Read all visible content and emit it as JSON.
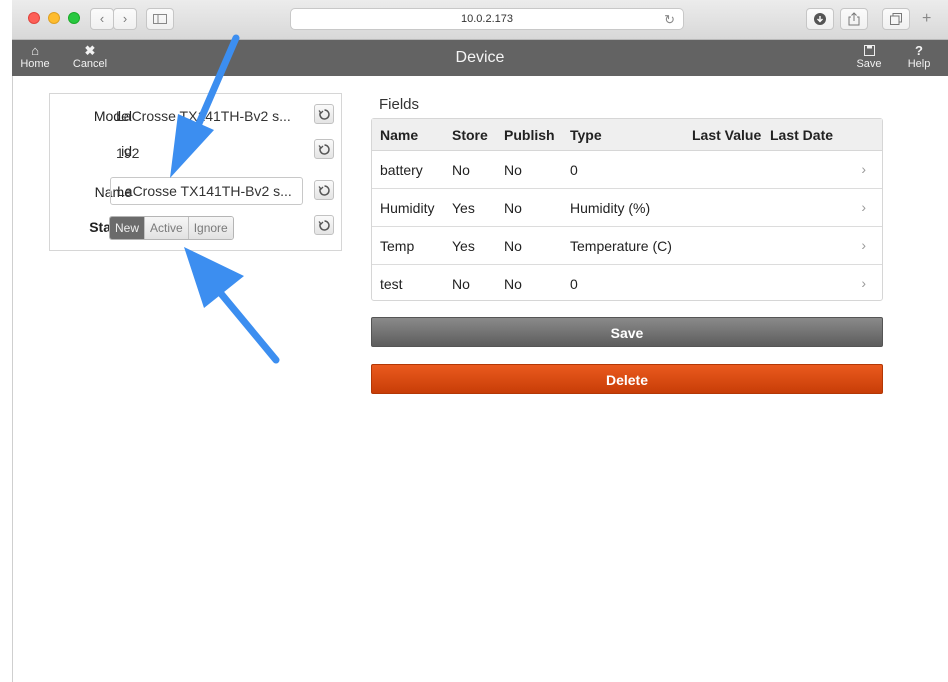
{
  "browser": {
    "address": "10.0.2.173",
    "back_glyph": "‹",
    "forward_glyph": "›",
    "plus_glyph": "+"
  },
  "navbar": {
    "title": "Device",
    "home_label": "Home",
    "cancel_label": "Cancel",
    "save_label": "Save",
    "help_label": "Help",
    "home_icon_glyph": "⌂",
    "cancel_icon_glyph": "✖",
    "help_icon_glyph": "?"
  },
  "device": {
    "model_label": "Model",
    "model_value": "LaCrosse TX141TH-Bv2 s...",
    "id_label": "id",
    "id_value": "192",
    "name_label": "Name",
    "name_value": "LaCrosse TX141TH-Bv2 s...",
    "status_label": "Status",
    "status_options": [
      "New",
      "Active",
      "Ignore"
    ],
    "status_selected": "New"
  },
  "fields": {
    "title": "Fields",
    "columns": [
      "Name",
      "Store",
      "Publish",
      "Type",
      "Last Value",
      "Last Date"
    ],
    "rows": [
      {
        "name": "battery",
        "store": "No",
        "publish": "No",
        "type": "0",
        "last_value": "",
        "last_date": ""
      },
      {
        "name": "Humidity",
        "store": "Yes",
        "publish": "No",
        "type": "Humidity (%)",
        "last_value": "",
        "last_date": ""
      },
      {
        "name": "Temp",
        "store": "Yes",
        "publish": "No",
        "type": "Temperature (C)",
        "last_value": "",
        "last_date": ""
      },
      {
        "name": "test",
        "store": "No",
        "publish": "No",
        "type": "0",
        "last_value": "",
        "last_date": ""
      }
    ],
    "row_chevron": "›"
  },
  "actions": {
    "save_label": "Save",
    "delete_label": "Delete"
  },
  "colors": {
    "navbar": "#636363",
    "delete": "#d9480f",
    "save": "#6e6e6e",
    "annotation_arrow": "#3c8ef0"
  }
}
